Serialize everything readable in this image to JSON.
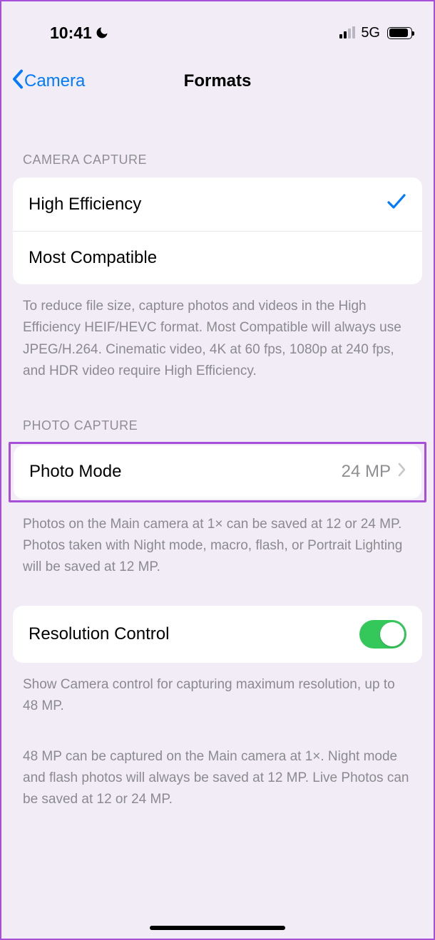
{
  "status": {
    "time": "10:41",
    "network": "5G"
  },
  "nav": {
    "back": "Camera",
    "title": "Formats"
  },
  "camera_capture": {
    "header": "CAMERA CAPTURE",
    "options": {
      "high_efficiency": "High Efficiency",
      "most_compatible": "Most Compatible",
      "selected": "high_efficiency"
    },
    "footer": "To reduce file size, capture photos and videos in the High Efficiency HEIF/HEVC format. Most Compatible will always use JPEG/H.264. Cinematic video, 4K at 60 fps, 1080p at 240 fps, and HDR video require High Efficiency."
  },
  "photo_capture": {
    "header": "PHOTO CAPTURE",
    "photo_mode_label": "Photo Mode",
    "photo_mode_value": "24 MP",
    "footer": "Photos on the Main camera at 1× can be saved at 12 or 24 MP. Photos taken with Night mode, macro, flash, or Portrait Lighting will be saved at 12 MP."
  },
  "resolution": {
    "label": "Resolution Control",
    "enabled": true,
    "footer1": "Show Camera control for capturing maximum resolution, up to 48 MP.",
    "footer2": "48 MP can be captured on the Main camera at 1×. Night mode and flash photos will always be saved at 12 MP. Live Photos can be saved at 12 or 24 MP."
  }
}
